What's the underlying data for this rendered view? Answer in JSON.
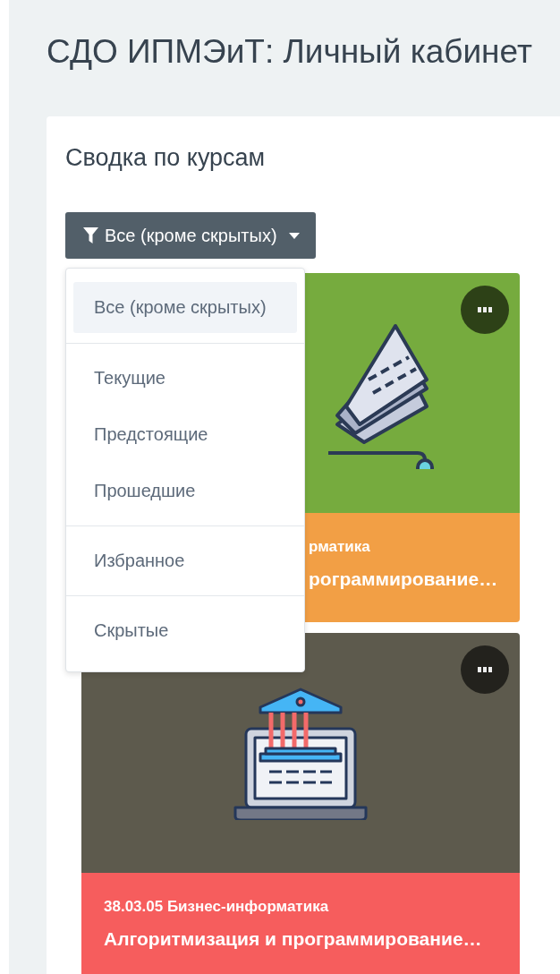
{
  "page_title": "СДО ИПМЭиТ: Личный кабинет",
  "block": {
    "title": "Сводка по курсам",
    "filter_button": {
      "label": "Все (кроме скрытых)"
    },
    "filter_menu": {
      "groups": [
        [
          {
            "label": "Все (кроме скрытых)",
            "selected": true
          }
        ],
        [
          {
            "label": "Текущие",
            "selected": false
          },
          {
            "label": "Предстоящие",
            "selected": false
          },
          {
            "label": "Прошедшие",
            "selected": false
          }
        ],
        [
          {
            "label": "Избранное",
            "selected": false
          }
        ],
        [
          {
            "label": "Скрытые",
            "selected": false
          }
        ]
      ]
    },
    "courses": [
      {
        "kind": "partly-covered",
        "category": "рматика",
        "name": "рограммирование…"
      },
      {
        "kind": "full",
        "category": "38.03.05 Бизнес-информатика",
        "name": "Алгоритмизация и программирование…"
      }
    ]
  }
}
